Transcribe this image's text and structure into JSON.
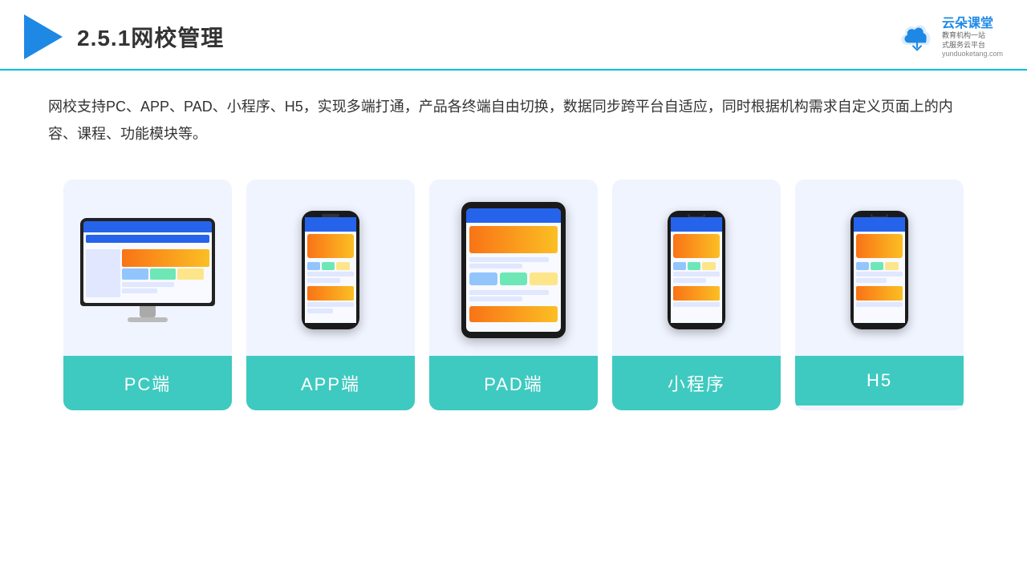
{
  "header": {
    "section_number": "2.5.1",
    "title": "网校管理",
    "brand": {
      "name": "云朵课堂",
      "domain": "yunduoketang.com",
      "tagline1": "教育机构一站",
      "tagline2": "式服务云平台"
    }
  },
  "description": {
    "text": "网校支持PC、APP、PAD、小程序、H5，实现多端打通，产品各终端自由切换，数据同步跨平台自适应，同时根据机构需求自定义页面上的内容、课程、功能模块等。"
  },
  "cards": [
    {
      "id": "pc",
      "label": "PC端"
    },
    {
      "id": "app",
      "label": "APP端"
    },
    {
      "id": "pad",
      "label": "PAD端"
    },
    {
      "id": "mini",
      "label": "小程序"
    },
    {
      "id": "h5",
      "label": "H5"
    }
  ],
  "colors": {
    "accent": "#3ecac0",
    "header_line": "#00bcd4",
    "blue": "#1e88e5",
    "card_bg": "#f0f4ff"
  }
}
